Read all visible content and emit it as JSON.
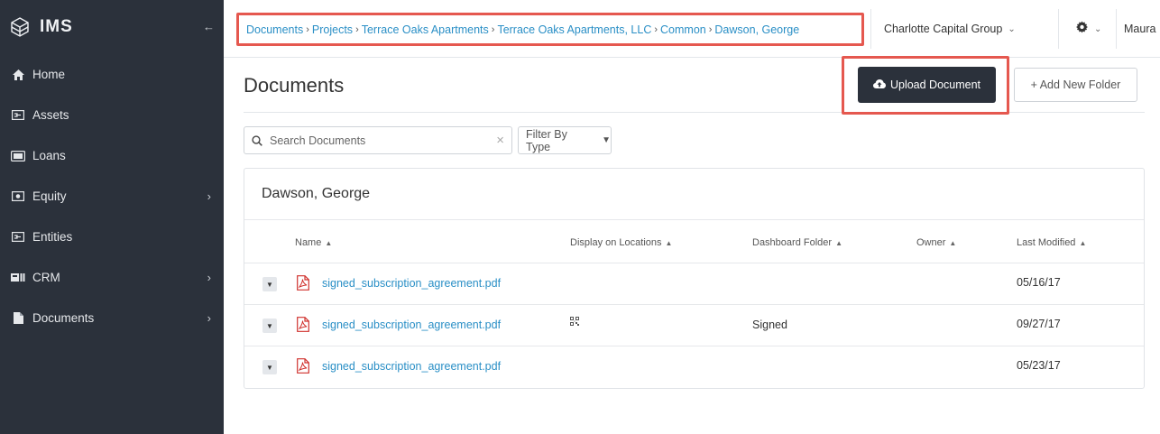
{
  "brand": {
    "name": "IMS"
  },
  "sidebar": {
    "collapse_icon": "arrow-left-icon",
    "items": [
      {
        "label": "Home",
        "icon": "home-icon",
        "has_submenu": false
      },
      {
        "label": "Assets",
        "icon": "assets-icon",
        "has_submenu": false
      },
      {
        "label": "Loans",
        "icon": "loans-icon",
        "has_submenu": false
      },
      {
        "label": "Equity",
        "icon": "equity-icon",
        "has_submenu": true
      },
      {
        "label": "Entities",
        "icon": "entities-icon",
        "has_submenu": false
      },
      {
        "label": "CRM",
        "icon": "crm-icon",
        "has_submenu": true
      },
      {
        "label": "Documents",
        "icon": "document-icon",
        "has_submenu": true
      }
    ]
  },
  "breadcrumb": [
    "Documents",
    "Projects",
    "Terrace Oaks Apartments",
    "Terrace Oaks Apartments, LLC",
    "Common",
    "Dawson, George"
  ],
  "topbar": {
    "company": "Charlotte Capital Group",
    "user": "Maura"
  },
  "page": {
    "title": "Documents",
    "upload_label": "Upload Document",
    "add_folder_label": "+ Add New Folder",
    "search_placeholder": "Search Documents",
    "filter_label": "Filter By Type"
  },
  "table": {
    "folder_title": "Dawson, George",
    "columns": [
      "Name",
      "Display on Locations",
      "Dashboard Folder",
      "Owner",
      "Last Modified"
    ],
    "rows": [
      {
        "name": "signed_subscription_agreement.pdf",
        "display_on_locations": "",
        "dashboard_folder": "",
        "owner": "",
        "last_modified": "05/16/17"
      },
      {
        "name": "signed_subscription_agreement.pdf",
        "display_on_locations": "qr-code-icon",
        "dashboard_folder": "Signed",
        "owner": "",
        "last_modified": "09/27/17"
      },
      {
        "name": "signed_subscription_agreement.pdf",
        "display_on_locations": "",
        "dashboard_folder": "",
        "owner": "",
        "last_modified": "05/23/17"
      }
    ]
  },
  "colors": {
    "sidebar_bg": "#2b313b",
    "link": "#2a8fc6",
    "highlight": "#e5584f",
    "pdf_red": "#d0312d"
  }
}
